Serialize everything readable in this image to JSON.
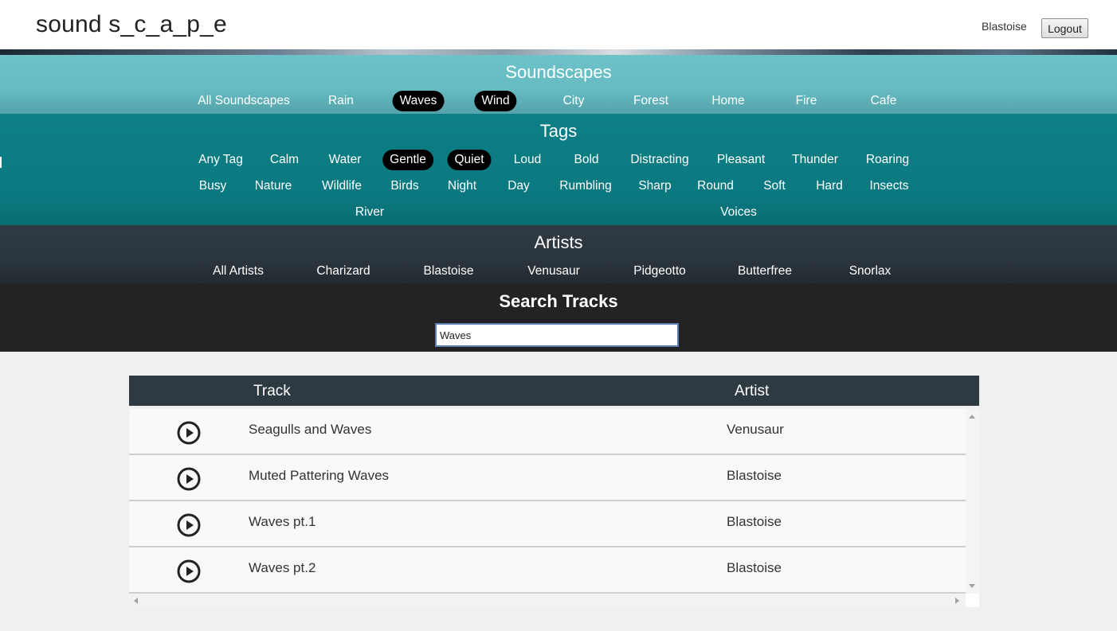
{
  "header": {
    "app_title": "sound s_c_a_p_e",
    "user_name": "Blastoise",
    "logout_label": "Logout"
  },
  "soundscapes": {
    "title": "Soundscapes",
    "items": [
      {
        "label": "All Soundscapes",
        "active": false
      },
      {
        "label": "Rain",
        "active": false
      },
      {
        "label": "Waves",
        "active": true
      },
      {
        "label": "Wind",
        "active": true
      },
      {
        "label": "City",
        "active": false
      },
      {
        "label": "Forest",
        "active": false
      },
      {
        "label": "Home",
        "active": false
      },
      {
        "label": "Fire",
        "active": false
      },
      {
        "label": "Cafe",
        "active": false
      }
    ]
  },
  "tags": {
    "title": "Tags",
    "items": [
      {
        "label": "Any Tag",
        "active": false
      },
      {
        "label": "Calm",
        "active": false
      },
      {
        "label": "Water",
        "active": false
      },
      {
        "label": "Gentle",
        "active": true
      },
      {
        "label": "Quiet",
        "active": true
      },
      {
        "label": "Loud",
        "active": false
      },
      {
        "label": "Bold",
        "active": false
      },
      {
        "label": "Distracting",
        "active": false
      },
      {
        "label": "Pleasant",
        "active": false
      },
      {
        "label": "Thunder",
        "active": false
      },
      {
        "label": "Roaring",
        "active": false
      },
      {
        "label": "Busy",
        "active": false
      },
      {
        "label": "Nature",
        "active": false
      },
      {
        "label": "Wildlife",
        "active": false
      },
      {
        "label": "Birds",
        "active": false
      },
      {
        "label": "Night",
        "active": false
      },
      {
        "label": "Day",
        "active": false
      },
      {
        "label": "Rumbling",
        "active": false
      },
      {
        "label": "Sharp",
        "active": false
      },
      {
        "label": "Round",
        "active": false
      },
      {
        "label": "Soft",
        "active": false
      },
      {
        "label": "Hard",
        "active": false
      },
      {
        "label": "Insects",
        "active": false
      },
      {
        "label": "River",
        "active": false
      },
      {
        "label": "Voices",
        "active": false
      }
    ]
  },
  "artists": {
    "title": "Artists",
    "items": [
      {
        "label": "All Artists",
        "active": false
      },
      {
        "label": "Charizard",
        "active": false
      },
      {
        "label": "Blastoise",
        "active": false
      },
      {
        "label": "Venusaur",
        "active": false
      },
      {
        "label": "Pidgeotto",
        "active": false
      },
      {
        "label": "Butterfree",
        "active": false
      },
      {
        "label": "Snorlax",
        "active": false
      }
    ]
  },
  "search": {
    "title": "Search Tracks",
    "value": "Waves"
  },
  "tracks_table": {
    "columns": [
      "Track",
      "Artist"
    ],
    "rows": [
      {
        "track": "Seagulls and Waves",
        "artist": "Venusaur"
      },
      {
        "track": "Muted Pattering Waves",
        "artist": "Blastoise"
      },
      {
        "track": "Waves pt.1",
        "artist": "Blastoise"
      },
      {
        "track": "Waves pt.2",
        "artist": "Blastoise"
      }
    ]
  },
  "icons": {
    "play": "play-circle-icon",
    "scroll_up": "chevron-up-icon",
    "scroll_down": "chevron-down-icon",
    "scroll_left": "chevron-left-icon",
    "scroll_right": "chevron-right-icon"
  },
  "colors": {
    "soundscapes_bg": "#6cc2c7",
    "tags_bg": "#0b7980",
    "artists_bg": "#2b353d",
    "search_bg": "#232323",
    "table_header_bg": "#2e3a42",
    "active_pill": "#000000"
  }
}
